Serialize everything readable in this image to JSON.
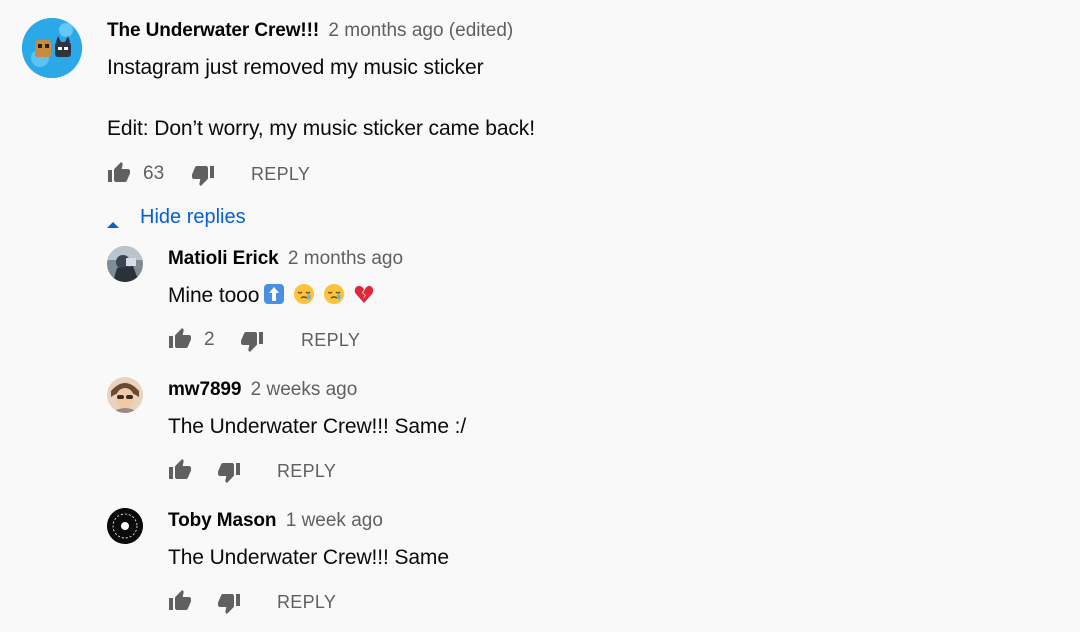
{
  "comment": {
    "author": "The Underwater Crew!!!",
    "time": "2 months ago (edited)",
    "line1": "Instagram just removed my music sticker",
    "line2": "Edit: Don’t worry, my music sticker came back!",
    "likes": "63",
    "reply_label": "REPLY"
  },
  "hide_replies_label": "Hide replies",
  "replies": [
    {
      "author": "Matioli Erick",
      "time": "2 months ago",
      "text": "Mine tooo",
      "likes": "2",
      "reply_label": "REPLY"
    },
    {
      "author": "mw7899",
      "time": "2 weeks ago",
      "text": "The Underwater Crew!!! Same :/",
      "likes": "",
      "reply_label": "REPLY"
    },
    {
      "author": "Toby Mason",
      "time": "1 week ago",
      "text": "The Underwater Crew!!! Same",
      "likes": "",
      "reply_label": "REPLY"
    }
  ],
  "icons": {
    "like": "thumbs-up-icon",
    "dislike": "thumbs-down-icon",
    "caret": "caret-up-icon"
  },
  "colors": {
    "link_blue": "#065fd4",
    "meta_gray": "#606060",
    "icon_gray": "#606060"
  }
}
